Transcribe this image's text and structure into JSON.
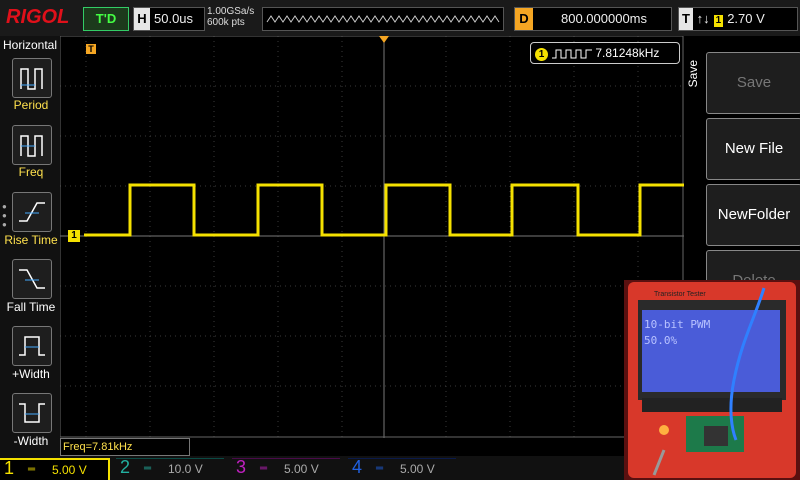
{
  "topbar": {
    "logo": "RIGOL",
    "trigger_status": "T'D",
    "horizontal_tag": "H",
    "timebase": "50.0us",
    "sample_rate": "1.00GSa/s",
    "memory_depth": "600k pts",
    "delay_tag": "D",
    "delay": "800.000000ms",
    "trigger_tag": "T",
    "trigger_edge": "↑↓",
    "trigger_channel": "1",
    "trigger_level": "2.70 V"
  },
  "left_menu": {
    "title": "Horizontal",
    "items": [
      {
        "label": "Period",
        "icon": "period-icon"
      },
      {
        "label": "Freq",
        "icon": "freq-icon"
      },
      {
        "label": "Rise Time",
        "icon": "rise-time-icon"
      },
      {
        "label": "Fall Time",
        "icon": "fall-time-icon"
      },
      {
        "label": "+Width",
        "icon": "positive-width-icon"
      },
      {
        "label": "-Width",
        "icon": "negative-width-icon"
      }
    ]
  },
  "right_menu": {
    "tab": "Save",
    "buttons": [
      {
        "label": "Save",
        "enabled": false
      },
      {
        "label": "New File",
        "enabled": true
      },
      {
        "label": "NewFolder",
        "enabled": true
      },
      {
        "label": "Delete",
        "enabled": false
      }
    ]
  },
  "frequency_badge": {
    "channel": "1",
    "value": "7.81248kHz"
  },
  "measurement": {
    "readout": "Freq=7.81kHz"
  },
  "channels": [
    {
      "number": "1",
      "scale": "5.00 V",
      "color": "#f5e100",
      "active": true
    },
    {
      "number": "2",
      "scale": "10.0 V",
      "color": "#22b0a0",
      "active": false
    },
    {
      "number": "3",
      "scale": "5.00 V",
      "color": "#c020c0",
      "active": false
    },
    {
      "number": "4",
      "scale": "5.00 V",
      "color": "#2060e0",
      "active": false
    }
  ],
  "markers": {
    "ch1_level": "1",
    "trigger_level_marker": "T",
    "trigger_position_marker": "T"
  },
  "inset_photo": {
    "board_title": "Transistor Tester",
    "lcd_line1": "10-bit PWM",
    "lcd_line2": "50.0%"
  },
  "colors": {
    "ch1": "#f5e100",
    "accent": "#f5a623",
    "brand": "#e0101a"
  }
}
